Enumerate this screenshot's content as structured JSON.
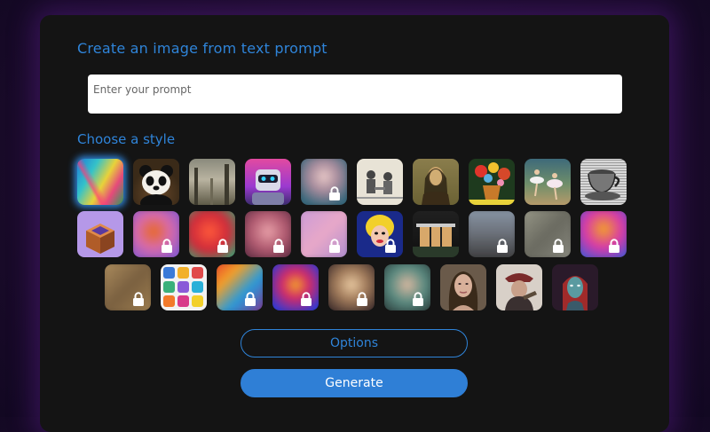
{
  "header": {
    "title": "Create an image from text prompt"
  },
  "prompt": {
    "placeholder": "Enter your prompt",
    "value": ""
  },
  "styles": {
    "label": "Choose a style",
    "rows": [
      [
        {
          "id": "abstract-paint",
          "locked": false,
          "selected": true
        },
        {
          "id": "panda",
          "locked": false,
          "selected": false
        },
        {
          "id": "misty-forest",
          "locked": false,
          "selected": false
        },
        {
          "id": "robot",
          "locked": false,
          "selected": false
        },
        {
          "id": "portrait-woman",
          "locked": true,
          "selected": false
        },
        {
          "id": "vintage-sketch",
          "locked": false,
          "selected": false
        },
        {
          "id": "mona-lisa",
          "locked": false,
          "selected": false
        },
        {
          "id": "flower-vase",
          "locked": false,
          "selected": false
        },
        {
          "id": "ballet-dancers",
          "locked": false,
          "selected": false
        },
        {
          "id": "engraved-cup",
          "locked": false,
          "selected": false
        }
      ],
      [
        {
          "id": "isometric-box",
          "locked": false,
          "selected": false
        },
        {
          "id": "fox",
          "locked": true,
          "selected": false
        },
        {
          "id": "red-glow",
          "locked": true,
          "selected": false
        },
        {
          "id": "pink-portrait",
          "locked": true,
          "selected": false
        },
        {
          "id": "pastel",
          "locked": true,
          "selected": false
        },
        {
          "id": "pop-art",
          "locked": true,
          "selected": false
        },
        {
          "id": "modern-house",
          "locked": false,
          "selected": false
        },
        {
          "id": "gray-landscape",
          "locked": true,
          "selected": false
        },
        {
          "id": "gray-blur",
          "locked": true,
          "selected": false
        },
        {
          "id": "neon-figure",
          "locked": true,
          "selected": false
        }
      ],
      [
        {
          "id": "brown-blur",
          "locked": true,
          "selected": false
        },
        {
          "id": "icon-grid",
          "locked": false,
          "selected": false
        },
        {
          "id": "colorful-swirl",
          "locked": true,
          "selected": false
        },
        {
          "id": "psychedelic",
          "locked": true,
          "selected": false
        },
        {
          "id": "fantasy-face",
          "locked": true,
          "selected": false
        },
        {
          "id": "teal-portrait",
          "locked": true,
          "selected": false
        },
        {
          "id": "realistic-woman",
          "locked": false,
          "selected": false
        },
        {
          "id": "man-with-hat",
          "locked": false,
          "selected": false
        },
        {
          "id": "warrior-portrait",
          "locked": false,
          "selected": false
        }
      ]
    ]
  },
  "buttons": {
    "options": "Options",
    "generate": "Generate"
  },
  "colors": {
    "accent": "#2f84d9",
    "panel": "#141414",
    "background": "#1c0b2c"
  }
}
